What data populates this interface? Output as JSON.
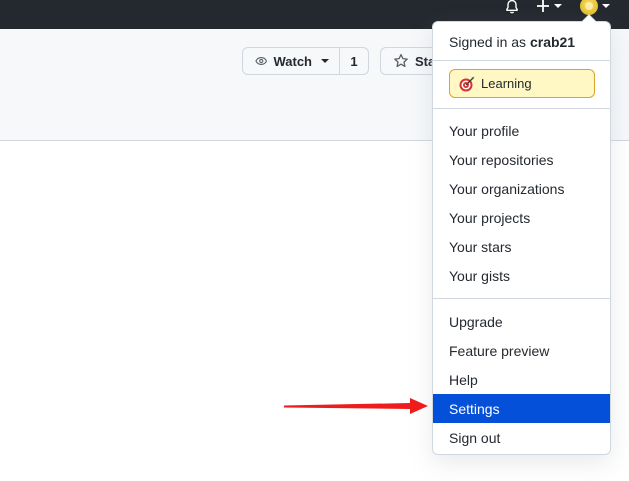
{
  "topbar": {
    "icons": [
      "bell-icon",
      "plus-icon",
      "avatar"
    ]
  },
  "repo_actions": {
    "watch_label": "Watch",
    "watch_count": "1",
    "star_label": "Star",
    "icons": [
      "eye-icon",
      "star-icon"
    ]
  },
  "user_menu": {
    "signed_in_prefix": "Signed in as",
    "username": "crab21",
    "status": {
      "emoji_icon": "dart-target-icon",
      "text": "Learning"
    },
    "items_group1": [
      {
        "label": "Your profile"
      },
      {
        "label": "Your repositories"
      },
      {
        "label": "Your organizations"
      },
      {
        "label": "Your projects"
      },
      {
        "label": "Your stars"
      },
      {
        "label": "Your gists"
      }
    ],
    "items_group2": [
      {
        "label": "Upgrade"
      },
      {
        "label": "Feature preview"
      },
      {
        "label": "Help"
      },
      {
        "label": "Settings",
        "highlighted": true
      },
      {
        "label": "Sign out"
      }
    ]
  },
  "annotation": {
    "arrow_color": "#ee1c1c",
    "points_to": "Settings"
  },
  "colors": {
    "header_bg": "#24292f",
    "highlight": "#0550d9",
    "status_bg": "#fff8c5"
  }
}
